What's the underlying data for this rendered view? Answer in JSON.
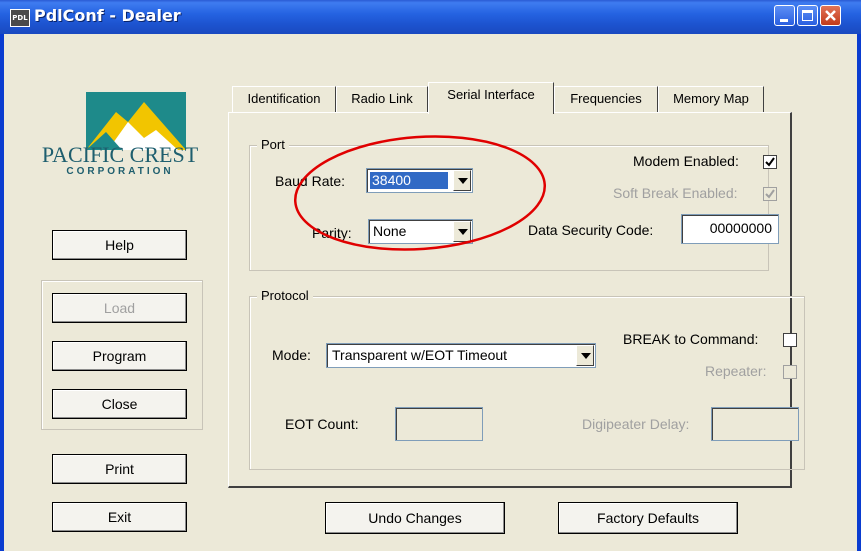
{
  "window": {
    "title": "PdlConf - Dealer",
    "icon_text": "PDL"
  },
  "logo": {
    "line1": "PACIFIC CREST",
    "line2": "CORPORATION"
  },
  "left_buttons": {
    "help": "Help",
    "load": "Load",
    "program": "Program",
    "close": "Close",
    "print": "Print",
    "exit": "Exit"
  },
  "tabs": [
    {
      "label": "Identification"
    },
    {
      "label": "Radio Link"
    },
    {
      "label": "Serial Interface"
    },
    {
      "label": "Frequencies"
    },
    {
      "label": "Memory Map"
    }
  ],
  "port": {
    "group_label": "Port",
    "baud_rate_label": "Baud Rate:",
    "baud_rate_value": "38400",
    "parity_label": "Parity:",
    "parity_value": "None",
    "modem_enabled_label": "Modem Enabled:",
    "modem_enabled": true,
    "soft_break_label": "Soft Break Enabled:",
    "soft_break": true,
    "security_code_label": "Data Security Code:",
    "security_code_value": "00000000"
  },
  "protocol": {
    "group_label": "Protocol",
    "mode_label": "Mode:",
    "mode_value": "Transparent w/EOT Timeout",
    "break_label": "BREAK to Command:",
    "break_checked": false,
    "repeater_label": "Repeater:",
    "repeater_checked": false,
    "eot_count_label": "EOT Count:",
    "eot_count_value": "",
    "digipeater_label": "Digipeater Delay:",
    "digipeater_value": ""
  },
  "bottom_buttons": {
    "undo": "Undo Changes",
    "factory": "Factory Defaults"
  },
  "colors": {
    "title_bar": "#2563e2",
    "highlight": "#316ac5",
    "annotation": "#e00000"
  }
}
